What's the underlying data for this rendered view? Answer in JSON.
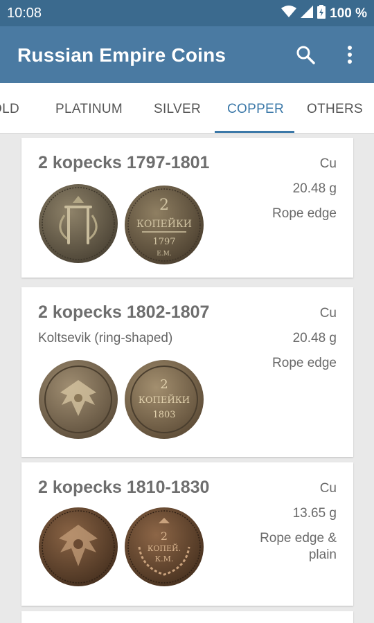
{
  "status_bar": {
    "time": "10:08",
    "battery": "100 %"
  },
  "app_bar": {
    "title": "Russian Empire Coins",
    "search_icon": "search-icon",
    "more_icon": "more-vert-icon"
  },
  "tabs": [
    "OLD",
    "PLATINUM",
    "SILVER",
    "COPPER",
    "OTHERS"
  ],
  "active_tab": "COPPER",
  "coins": [
    {
      "title": "2 kopecks 1797-1801",
      "subtitle": "",
      "metal": "Cu",
      "weight": "20.48 g",
      "edge": "Rope edge",
      "reverse_text": [
        "2",
        "КОПЕЙКИ",
        "1797",
        "Е.М."
      ]
    },
    {
      "title": "2 kopecks 1802-1807",
      "subtitle": "Koltsevik (ring-shaped)",
      "metal": "Cu",
      "weight": "20.48 g",
      "edge": "Rope edge",
      "reverse_text": [
        "2",
        "КОПЕЙКИ",
        "1803"
      ]
    },
    {
      "title": "2 kopecks 1810-1830",
      "subtitle": "",
      "metal": "Cu",
      "weight": "13.65 g",
      "edge": "Rope edge & plain",
      "reverse_text": [
        "2",
        "КОПЕЙ.",
        "К.М."
      ]
    }
  ],
  "colors": {
    "status_bar": "#3b6a8e",
    "app_bar": "#4a7aa2",
    "accent": "#3b78a8"
  }
}
